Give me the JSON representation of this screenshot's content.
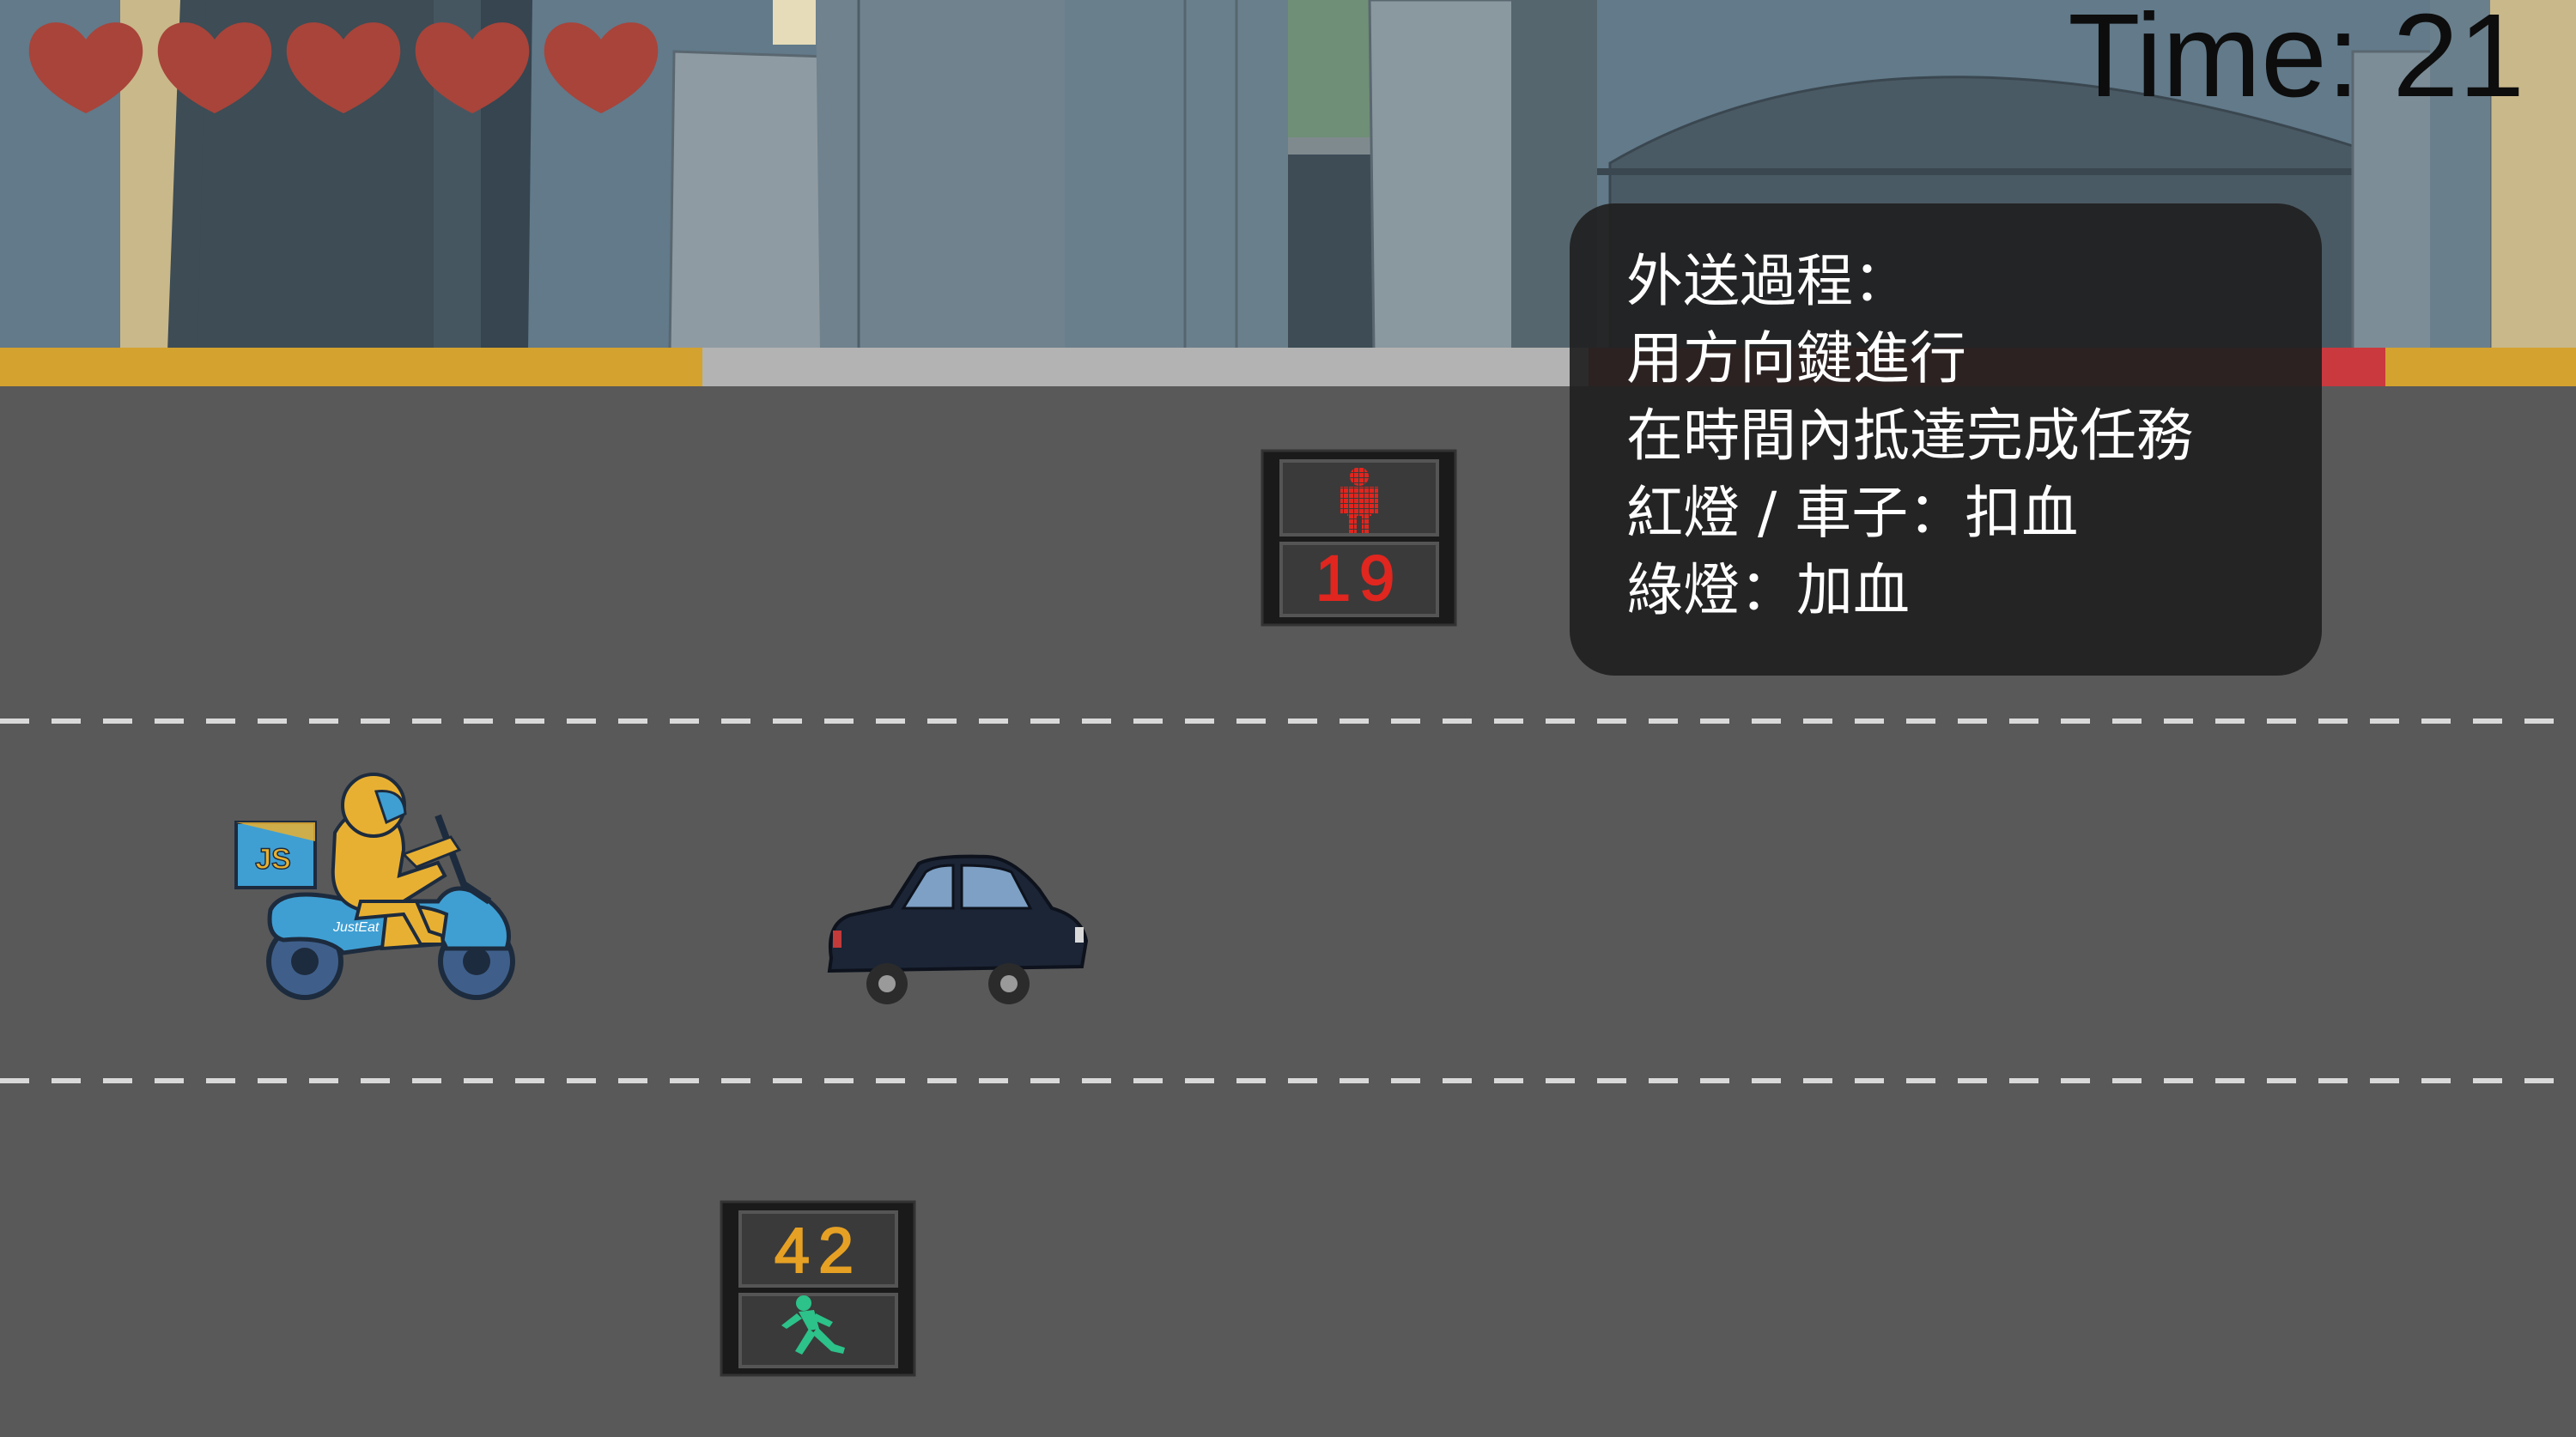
{
  "hud": {
    "lives": 5,
    "time_label": "Time: 21",
    "heart_color": "#a8443a"
  },
  "instructions": {
    "lines": [
      "外送過程：",
      "用方向鍵進行",
      "在時間內抵達完成任務",
      "紅燈 / 車子：扣血",
      "綠燈：加血"
    ]
  },
  "signals": {
    "upper": {
      "state": "red",
      "countdown": "19",
      "icon": "red-standing-person-icon"
    },
    "lower": {
      "state": "green",
      "countdown": "42",
      "icon": "green-walking-person-icon"
    }
  },
  "player": {
    "box_text": "JS",
    "scooter_text": "JustEat",
    "icon": "delivery-scooter-rider"
  },
  "colors": {
    "sky": "#627a8a",
    "road": "#595959",
    "curb_yellow": "#d4a22e",
    "curb_gray": "#b3b3b3",
    "curb_red": "#c9393e",
    "lane_dash": "#d9d9d9",
    "red_light": "#e0261f",
    "green_light": "#2cc28a",
    "amber_digits": "#e6a124"
  }
}
